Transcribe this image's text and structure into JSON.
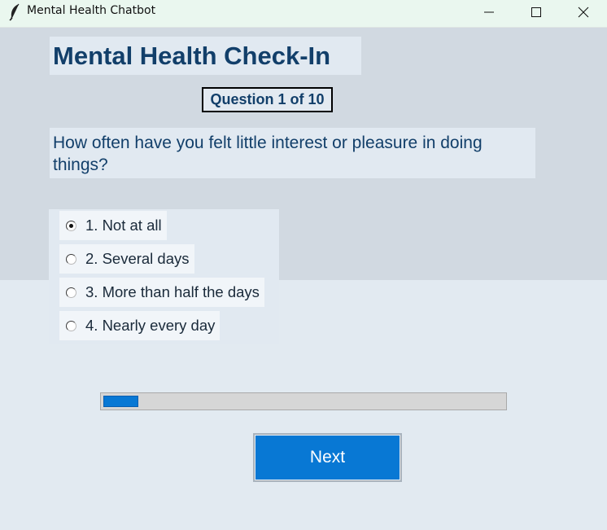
{
  "window": {
    "title": "Mental Health Chatbot",
    "icon": "feather-icon",
    "controls": [
      "minimize-icon",
      "maximize-icon",
      "close-icon"
    ]
  },
  "header": {
    "title": "Mental Health Check-In"
  },
  "progress": {
    "label": "Question 1 of 10",
    "current": 1,
    "total": 10,
    "fraction": 0.1
  },
  "question": {
    "text": "How often have you felt little interest or pleasure in doing things?"
  },
  "options": [
    {
      "label": "1. Not at all",
      "selected": true
    },
    {
      "label": "2. Several days",
      "selected": false
    },
    {
      "label": "3. More than half the days",
      "selected": false
    },
    {
      "label": "4. Nearly every day",
      "selected": false
    }
  ],
  "actions": {
    "next_label": "Next"
  },
  "colors": {
    "accent": "#0878d4",
    "heading_text": "#123f6a",
    "panel_bg": "#d1d9e1",
    "page_bg": "#e2eaf1",
    "titlebar_bg": "#eaf7ef"
  }
}
